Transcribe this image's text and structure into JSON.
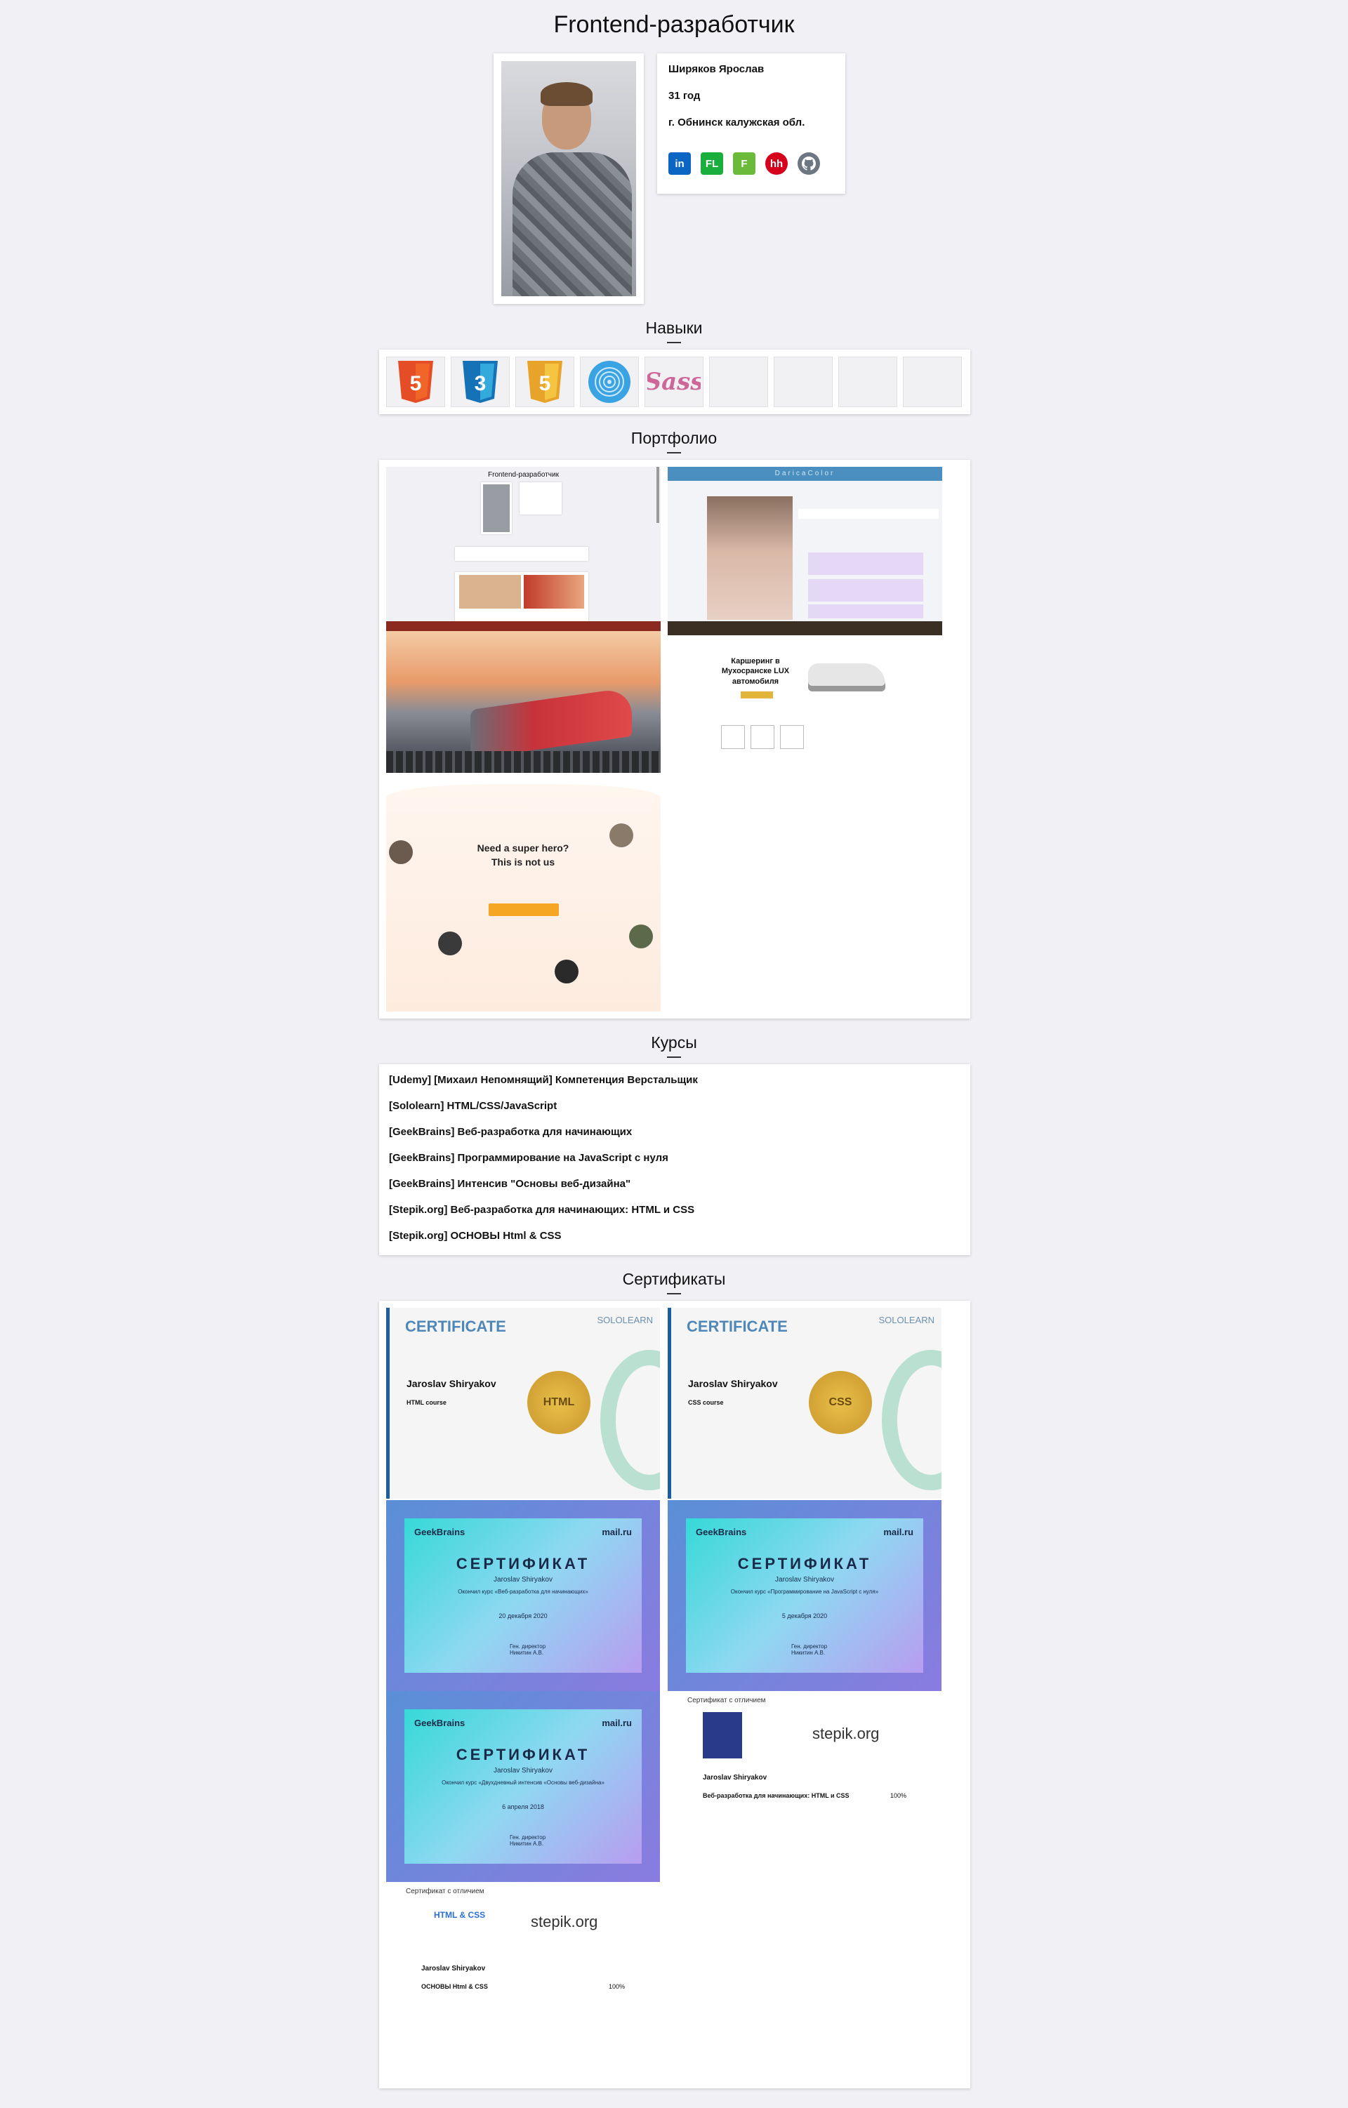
{
  "page": {
    "title": "Frontend-разработчик"
  },
  "profile": {
    "name": "Ширяков Ярослав",
    "age": "31 год",
    "city": "г. Обнинск калужская обл.",
    "socials": [
      {
        "icon": "linkedin-icon",
        "label": "in"
      },
      {
        "icon": "fl-icon",
        "label": "FL"
      },
      {
        "icon": "freelance-icon",
        "label": "F"
      },
      {
        "icon": "hh-icon",
        "label": "hh"
      },
      {
        "icon": "github-icon",
        "label": ""
      }
    ]
  },
  "sections": {
    "skills": "Навыки",
    "portfolio": "Портфолио",
    "courses": "Курсы",
    "certificates": "Сертификаты"
  },
  "skills": [
    "html5-icon",
    "css3-icon",
    "javascript-icon",
    "fingerprint-icon",
    "sass-icon",
    "",
    "",
    "",
    ""
  ],
  "portfolio": {
    "p1_title": "Frontend-разработчик",
    "p2_title": "DaricaColor",
    "p4_heading": "Каршеринг в Мухосранске LUX автомобиля",
    "p5_heading": "Need a super hero? This is not us"
  },
  "courses": [
    "[Udemy] [Михаил Непомнящий] Компетенция Верстальщик",
    "[Sololearn] HTML/CSS/JavaScript",
    "[GeekBrains] Веб-разработка для начинающих",
    "[GeekBrains] Программирование на JavaScript с нуля",
    "[GeekBrains] Интенсив \"Основы веб-дизайна\"",
    "[Stepik.org] Веб-разработка для начинающих: HTML и CSS",
    "[Stepik.org] ОСНОВЫ Html & CSS"
  ],
  "certificates": {
    "solo_title": "CERTIFICATE",
    "solo_brand": "SOLOLEARN",
    "solo_name": "Jaroslav Shiryakov",
    "solo1_course": "HTML course",
    "solo1_seal": "HTML",
    "solo2_course": "CSS course",
    "solo2_seal": "CSS",
    "gb_brand": "GeekBrains",
    "gb_partner": "mail.ru",
    "gb_title": "СЕРТИФИКАТ",
    "gb_name": "Jaroslav Shiryakov",
    "gb1_course": "Окончил курс «Веб-разработка для начинающих»",
    "gb1_date": "20 декабря 2020",
    "gb2_course": "Окончил курс «Программирование на JavaScript с нуля»",
    "gb2_date": "5 декабря 2020",
    "gb3_course": "Окончил курс «Двухдневный интенсив «Основы веб-дизайна»",
    "gb3_date": "6 апреля 2018",
    "gb_director": "Ген. директор Никитин А.В.",
    "stepik_header": "Сертификат с отличием",
    "stepik_brand": "stepik.org",
    "stepik_name": "Jaroslav Shiryakov",
    "stepik1_course": "Веб-разработка для начинающих: HTML и CSS",
    "stepik2_logo": "HTML & CSS",
    "stepik2_course": "ОСНОВЫ Html & CSS",
    "stepik_score": "100%"
  }
}
